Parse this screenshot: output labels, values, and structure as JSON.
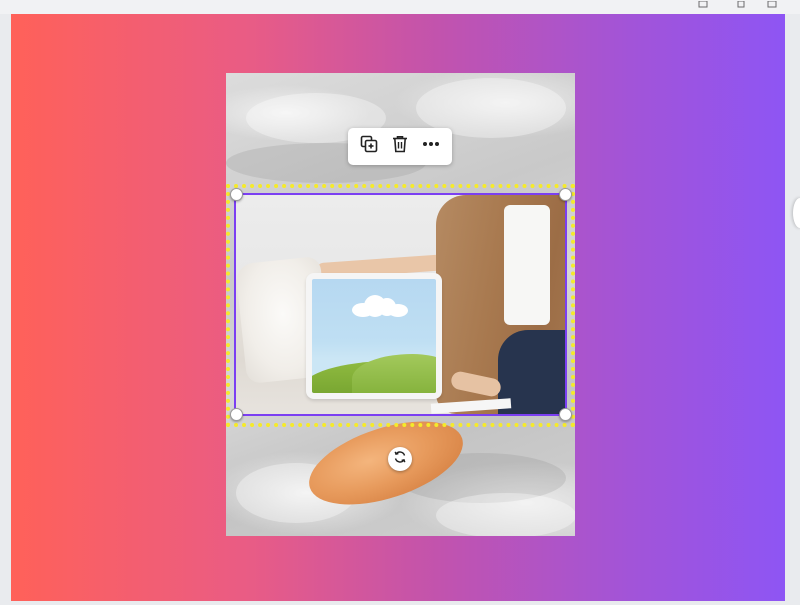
{
  "window": {
    "controls": [
      "window-menu-icon",
      "window-minimize-icon",
      "window-close-icon"
    ]
  },
  "canvas": {
    "gradient_colors": [
      "#ff6159",
      "#ea5c84",
      "#c253ad",
      "#a254d8",
      "#8e55f4"
    ]
  },
  "page": {
    "background_image": "bedsheet-with-cat-photo"
  },
  "element_toolbar": {
    "icons": [
      "duplicate-icon",
      "delete-icon",
      "more-options-icon"
    ]
  },
  "selected_element": {
    "image": "woman-on-sofa-with-landscape-pillow-photo",
    "selection_color": "#7b3ff2",
    "frame_color": "#f5ea2a",
    "handles": [
      "top-left",
      "top-right",
      "bottom-left",
      "bottom-right"
    ]
  },
  "rotate_control": {
    "icon": "rotate-icon"
  }
}
